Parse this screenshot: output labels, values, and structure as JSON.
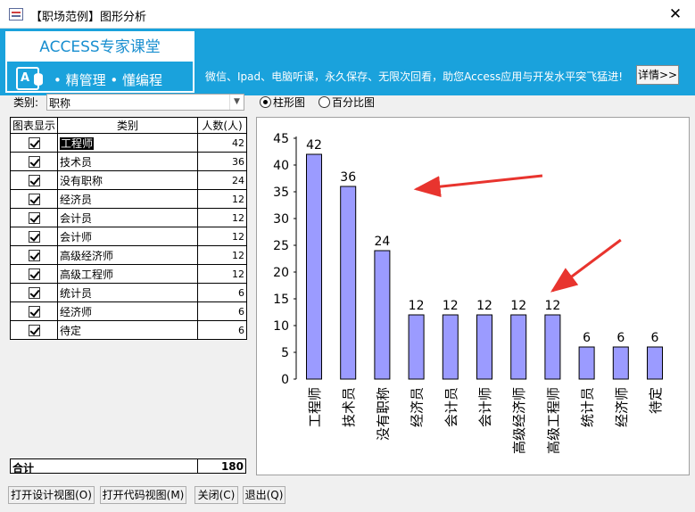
{
  "window": {
    "title": "【职场范例】图形分析",
    "close_glyph": "✕"
  },
  "banner": {
    "brand_title": "ACCESS专家课堂",
    "brand_icon_letter": "A",
    "brand_sub": "• 精管理 • 懂编程",
    "promo": "微信、Ipad、电脑听课，永久保存、无限次回看，助您Access应用与开发水平突飞猛进!",
    "details_button": "详情>>"
  },
  "filter": {
    "label": "类别:",
    "value": "职称"
  },
  "chart_mode": {
    "options": [
      {
        "label": "柱形图",
        "selected": true
      },
      {
        "label": "百分比图",
        "selected": false
      }
    ]
  },
  "table": {
    "headers": [
      "图表显示",
      "类别",
      "人数(人)"
    ],
    "rows": [
      {
        "show": true,
        "name": "工程师",
        "count": "42",
        "selected": true
      },
      {
        "show": true,
        "name": "技术员",
        "count": "36"
      },
      {
        "show": true,
        "name": "没有职称",
        "count": "24"
      },
      {
        "show": true,
        "name": "经济员",
        "count": "12"
      },
      {
        "show": true,
        "name": "会计员",
        "count": "12"
      },
      {
        "show": true,
        "name": "会计师",
        "count": "12"
      },
      {
        "show": true,
        "name": "高级经济师",
        "count": "12"
      },
      {
        "show": true,
        "name": "高级工程师",
        "count": "12"
      },
      {
        "show": true,
        "name": "统计员",
        "count": "6"
      },
      {
        "show": true,
        "name": "经济师",
        "count": "6"
      },
      {
        "show": true,
        "name": "待定",
        "count": "6"
      }
    ],
    "total_label": "合计",
    "total_value": "180"
  },
  "chart_data": {
    "type": "bar",
    "categories": [
      "工程师",
      "技术员",
      "没有职称",
      "经济员",
      "会计员",
      "会计师",
      "高级经济师",
      "高级工程师",
      "统计员",
      "经济师",
      "待定"
    ],
    "values": [
      42,
      36,
      24,
      12,
      12,
      12,
      12,
      12,
      6,
      6,
      6
    ],
    "ylim": [
      0,
      45
    ],
    "yticks": [
      0,
      5,
      10,
      15,
      20,
      25,
      30,
      35,
      40,
      45
    ],
    "bar_color": "#9b9bff",
    "annotation_color": "#e8342e",
    "annotations": [
      {
        "type": "arrow",
        "from": [
          6.7,
          38
        ],
        "to": [
          3.0,
          35.5
        ]
      },
      {
        "type": "arrow",
        "from": [
          9.0,
          26
        ],
        "to": [
          7.0,
          16.5
        ]
      }
    ]
  },
  "buttons": {
    "design_view": "打开设计视图(O)",
    "code_view": "打开代码视图(M)",
    "close": "关闭(C)",
    "exit": "退出(Q)"
  }
}
